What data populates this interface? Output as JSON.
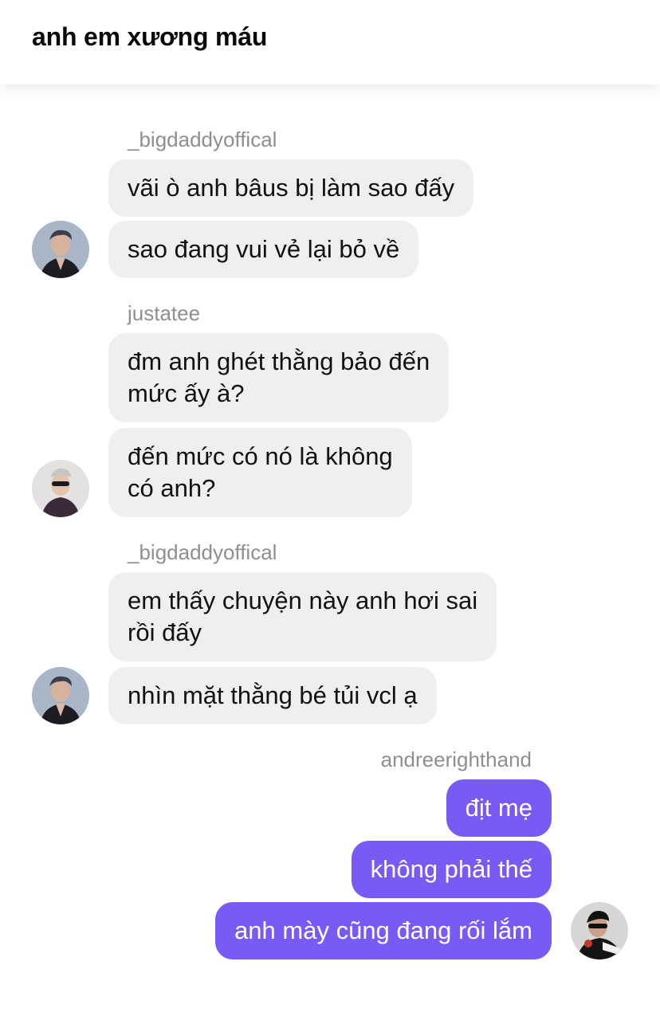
{
  "header": {
    "title": "anh em xương máu"
  },
  "groups": [
    {
      "sender": "_bigdaddyoffical",
      "avatar_icon": "user-avatar-bigdaddy",
      "messages": [
        "vãi ò anh bâus bị làm sao đấy",
        "sao đang vui vẻ lại bỏ về"
      ]
    },
    {
      "sender": "justatee",
      "avatar_icon": "user-avatar-justatee",
      "messages": [
        "đm anh ghét thằng bảo đến\nmức ấy à?",
        "đến mức có nó là không\ncó anh?"
      ]
    },
    {
      "sender": "_bigdaddyoffical",
      "avatar_icon": "user-avatar-bigdaddy",
      "messages": [
        "em thấy chuyện này anh hơi sai\nrồi đấy",
        "nhìn mặt thằng bé tủi vcl ạ"
      ]
    },
    {
      "sender": "andreerighthand",
      "avatar_icon": "user-avatar-andree",
      "messages": [
        "địt mẹ",
        "không phải thế",
        "anh mày cũng đang rối lắm"
      ]
    }
  ],
  "colors": {
    "incoming_bubble": "#efeff1",
    "outgoing_bubble": "#7a5af5"
  }
}
